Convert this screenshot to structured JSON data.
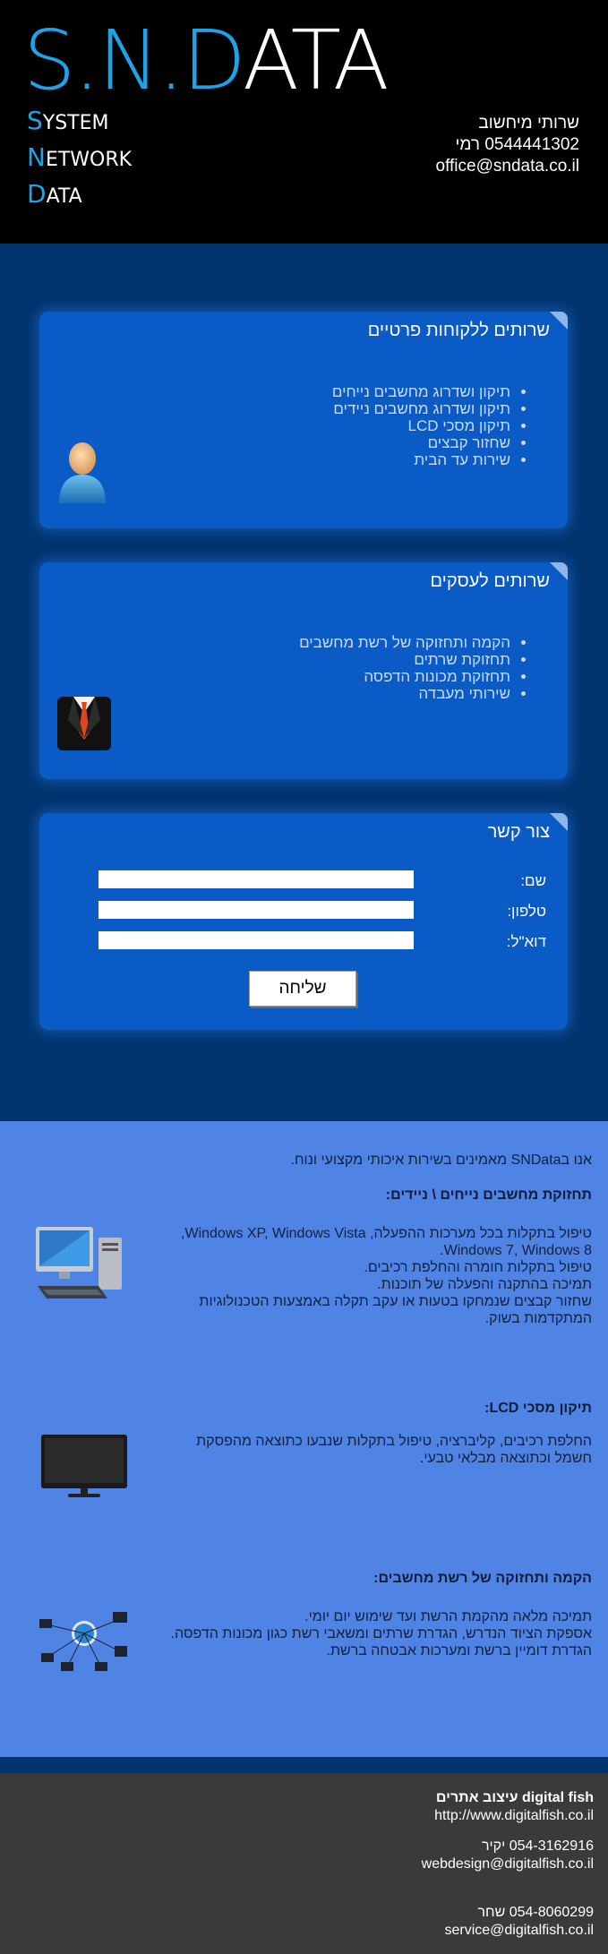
{
  "header": {
    "logo_blue": "S.N.D",
    "logo_white": "ATA",
    "lines": [
      {
        "cap": "S",
        "rest": "YSTEM"
      },
      {
        "cap": "N",
        "rest": "ETWORK"
      },
      {
        "cap": "D",
        "rest": "ATA"
      }
    ],
    "contact": {
      "title": "שרותי מיחשוב",
      "phone_line": "0544441302 רמי",
      "email": "office@sndata.co.il"
    }
  },
  "private_services": {
    "title": "שרותים ללקוחות פרטיים",
    "items": [
      "תיקון ושדרוג מחשבים נייחים",
      "תיקון ושדרוג מחשבים ניידים",
      "תיקון מסכי LCD",
      "שחזור קבצים",
      "שירות עד הבית"
    ]
  },
  "business_services": {
    "title": "שרותים לעסקים",
    "items": [
      "הקמה ותחזוקה של רשת מחשבים",
      "תחזוקת שרתים",
      "תחזוקת מכונות הדפסה",
      "שירותי מעבדה"
    ]
  },
  "contact_form": {
    "title": "צור קשר",
    "name_label": "שם:",
    "phone_label": "טלפון:",
    "email_label": "דוא\"ל:",
    "name_value": "",
    "phone_value": "",
    "email_value": "",
    "submit_label": "שליחה"
  },
  "info": {
    "intro": "אנו בSNData מאמינים בשירות איכותי מקצועי ונוח.",
    "sections": [
      {
        "title": "תחזוקת מחשבים נייחים \\ ניידים:",
        "lines": [
          "טיפול בתקלות בכל מערכות ההפעלה, Windows XP, Windows Vista,",
          "Windows 7, Windows 8.",
          "טיפול בתקלות חומרה והחלפת רכיבים.",
          "תמיכה בהתקנה והפעלה של תוכנות.",
          "שחזור קבצים שנמחקו בטעות או עקב תקלה באמצעות הטכנולוגיות",
          "המתקדמות בשוק."
        ]
      },
      {
        "title": "תיקון מסכי LCD:",
        "lines": [
          "החלפת רכיבים, קליברציה, טיפול בתקלות שנבעו כתוצאה מהפסקת",
          "חשמל וכתוצאה מבלאי טבעי."
        ]
      },
      {
        "title": "הקמה ותחזוקה של רשת מחשבים:",
        "lines": [
          "תמיכה מלאה מהקמת הרשת ועד שימוש יום יומי.",
          "אספקת הציוד הנדרש, הגדרת שרתים ומשאבי רשת כגון מכונות הדפסה.",
          "הגדרת דומיין ברשת ומערכות אבטחה ברשת."
        ]
      }
    ]
  },
  "footer": {
    "company": "digital fish עיצוב אתרים",
    "website": "http://www.digitalfish.co.il",
    "contact1_phone": "054-3162916 יקיר",
    "contact1_email": "webdesign@digitalfish.co.il",
    "contact2_phone": "054-8060299 שחר",
    "contact2_email": "service@digitalfish.co.il"
  },
  "colors": {
    "accent": "#1fa3e8",
    "panel": "#0b5bc6",
    "dark_blue": "#01346e",
    "light_blue": "#4f84e5",
    "footer": "#3a3a3a"
  }
}
